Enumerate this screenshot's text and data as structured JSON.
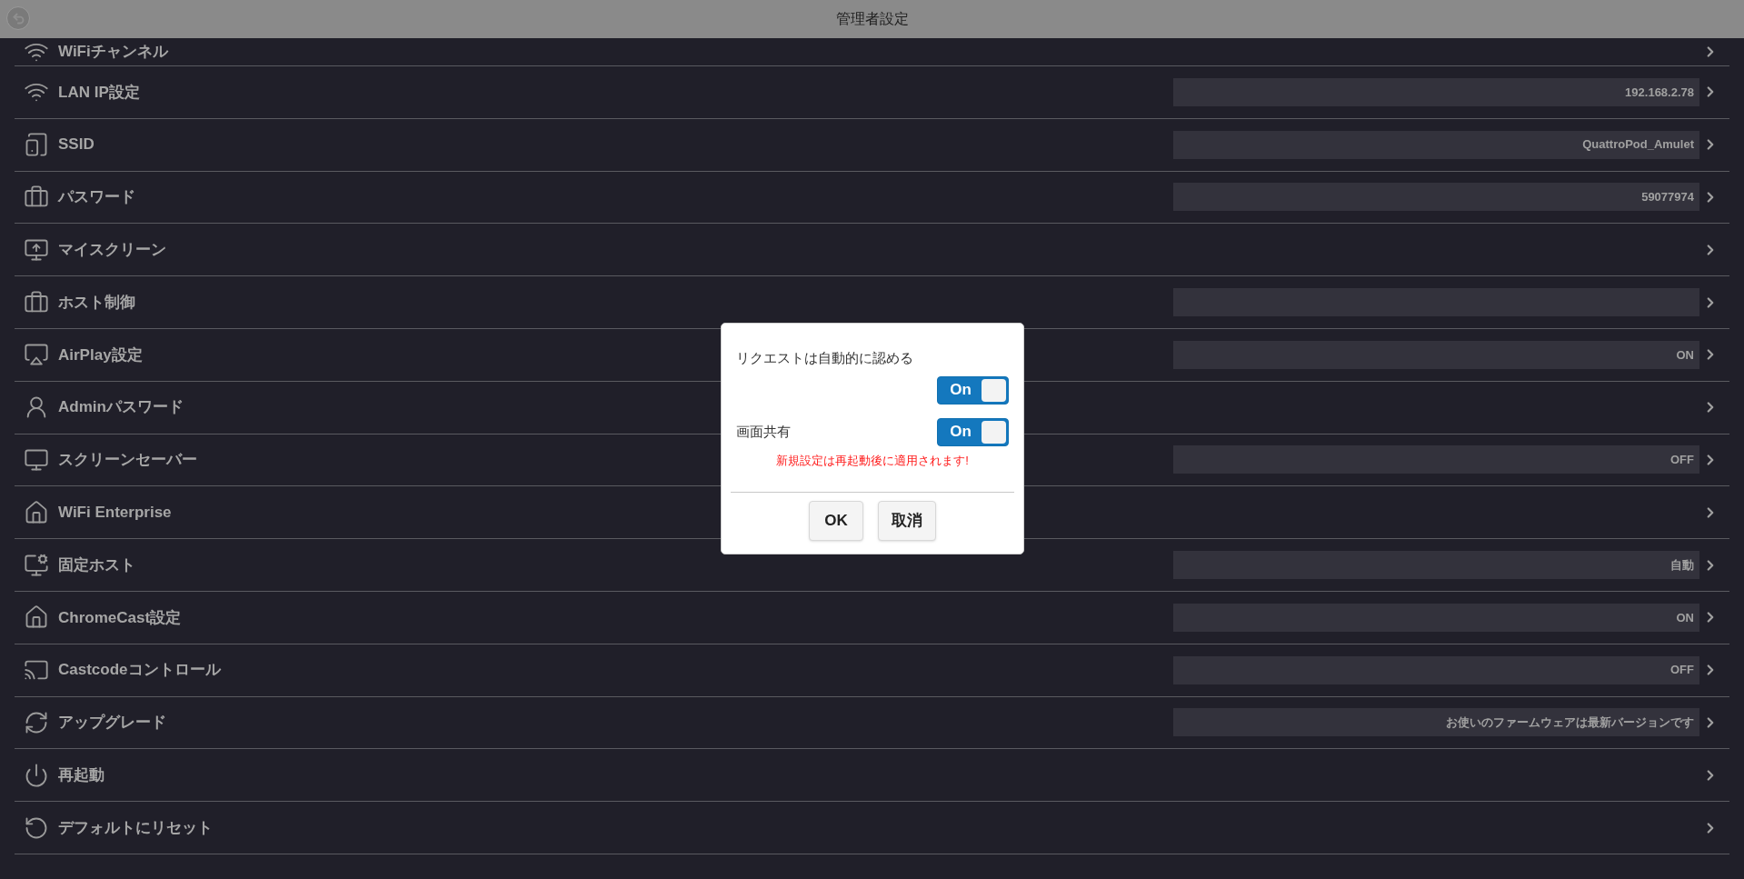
{
  "header": {
    "title": "管理者設定"
  },
  "rows": [
    {
      "label": "WiFiチャンネル",
      "kind": "plain"
    },
    {
      "label": "LAN IP設定",
      "kind": "field",
      "value": "192.168.2.78"
    },
    {
      "label": "SSID",
      "kind": "field",
      "value": "QuattroPod_Amulet"
    },
    {
      "label": "パスワード",
      "kind": "field",
      "value": "59077974"
    },
    {
      "label": "マイスクリーン",
      "kind": "plain"
    },
    {
      "label": "ホスト制御",
      "kind": "field"
    },
    {
      "label": "AirPlay設定",
      "kind": "field",
      "value": "ON"
    },
    {
      "label": "Adminパスワード",
      "kind": "plain"
    },
    {
      "label": "スクリーンセーバー",
      "kind": "field",
      "value": "OFF"
    },
    {
      "label": "WiFi Enterprise",
      "kind": "plain"
    },
    {
      "label": "固定ホスト",
      "kind": "field",
      "value": "自動"
    },
    {
      "label": "ChromeCast設定",
      "kind": "field",
      "value": "ON"
    },
    {
      "label": "Castcodeコントロール",
      "kind": "field",
      "value": "OFF"
    },
    {
      "label": "アップグレード",
      "kind": "field",
      "value": "お使いのファームウェアは最新バージョンです"
    },
    {
      "label": "再起動",
      "kind": "plain"
    },
    {
      "label": "デフォルトにリセット",
      "kind": "plain"
    }
  ],
  "dialog": {
    "toggles": [
      {
        "label": "リクエストは自動的に認める",
        "text": "On",
        "on": true
      },
      {
        "label": "画面共有",
        "text": "On",
        "on": true
      }
    ],
    "warning": "新規設定は再起動後に適用されます!",
    "buttons": [
      "OK",
      "取消"
    ]
  }
}
